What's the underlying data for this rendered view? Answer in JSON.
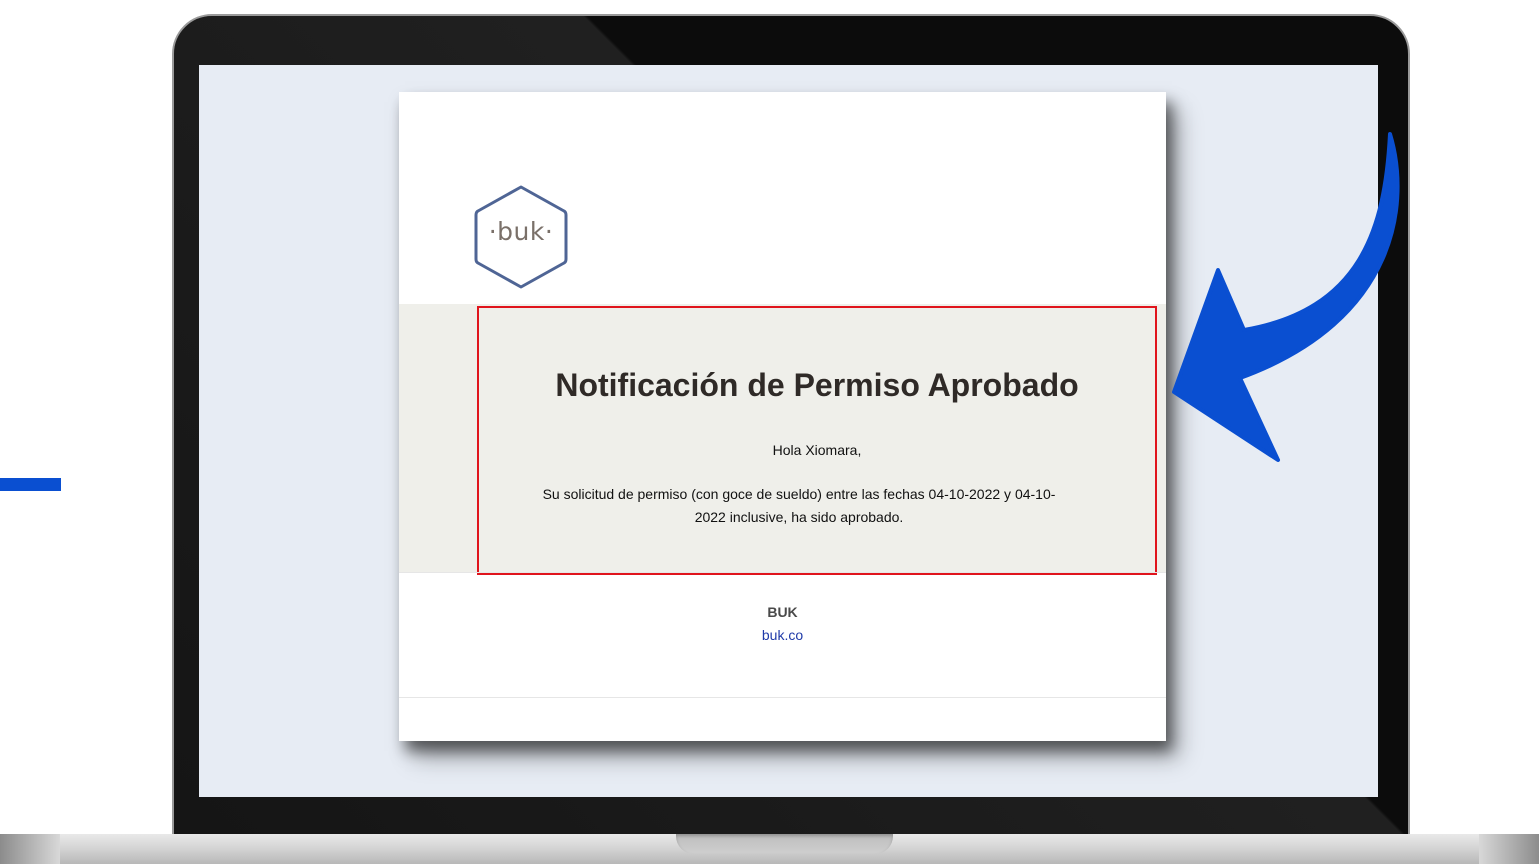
{
  "email": {
    "logo_text": "·buk·",
    "title": "Notificación de Permiso Aprobado",
    "greeting": "Hola Xiomara,",
    "body": "Su solicitud de permiso (con goce de sueldo) entre las fechas 04-10-2022 y 04-10-2022 inclusive, ha sido aprobado.",
    "footer": {
      "company": "BUK",
      "link": "buk.co"
    }
  },
  "colors": {
    "accent_blue": "#0a4fd1",
    "highlight_red": "#e0141c",
    "screen_bg": "#e7ecf4",
    "content_band": "#efefea",
    "logo_hex": "#4f6595",
    "link": "#1f3aa8"
  },
  "icons": {
    "logo": "buk-hexagon-logo",
    "pointer": "curved-arrow-icon"
  }
}
